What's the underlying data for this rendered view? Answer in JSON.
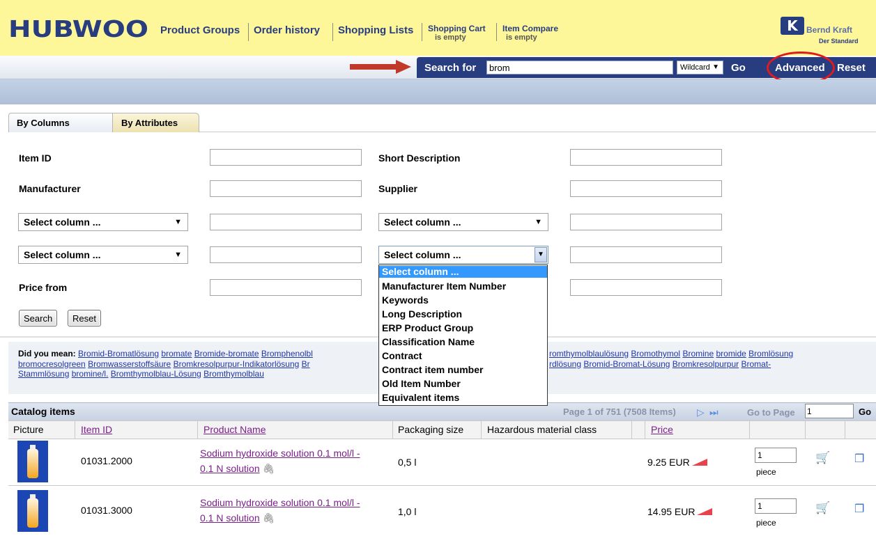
{
  "header": {
    "logo": "HUBWOO",
    "nav": [
      "Product Groups",
      "Order history",
      "Shopping Lists"
    ],
    "shopping_cart": "Shopping Cart",
    "shopping_cart_status": "is empty",
    "item_compare": "Item Compare",
    "item_compare_status": "is empty",
    "brand_mark": "K",
    "brand_name": "Bernd Kraft",
    "brand_tagline": "Der Standard"
  },
  "search": {
    "label": "Search for",
    "value": "brom",
    "mode": "Wildcard",
    "go": "Go",
    "advanced": "Advanced",
    "reset": "Reset"
  },
  "tabs": [
    "By Columns",
    "By Attributes"
  ],
  "form": {
    "item_id": "Item ID",
    "short_description": "Short Description",
    "manufacturer": "Manufacturer",
    "supplier": "Supplier",
    "select_column": "Select column ...",
    "price_from": "Price from",
    "search_button": "Search",
    "reset_button": "Reset"
  },
  "dropdown_options": [
    "Select column ...",
    "Manufacturer Item Number",
    "Keywords",
    "Long Description",
    "ERP Product Group",
    "Classification Name",
    "Contract",
    "Contract item number",
    "Old Item Number",
    "Equivalent items"
  ],
  "did_you_mean": {
    "label": "Did you mean:",
    "line1": [
      "Bromid-Bromatlösung",
      "bromate",
      "Bromide-bromate",
      "Bromphenolbl"
    ],
    "line1_right": [
      "romthymolblaulösung",
      "Bromothymol",
      "Bromine",
      "bromide",
      "Bromlösung"
    ],
    "line2": [
      "bromocresolgreen",
      "Bromwasserstoffsäure",
      "Bromkresolpurpur-Indikatorlösung",
      "Br"
    ],
    "line2_right": [
      "rdlösung",
      "Bromid-Bromat-Lösung",
      "Bromkresolpurpur",
      "Bromat-"
    ],
    "line3": [
      "Stammlösung",
      "bromine/l.",
      "Bromthymolblau-Lösung",
      "Bromthymolblau"
    ]
  },
  "catalog": {
    "title": "Catalog items",
    "page_info": "Page 1 of 751 (7508 Items)",
    "go_to_page": "Go to Page",
    "go_to_page_value": "1",
    "go": "Go",
    "columns": [
      "Picture",
      "Item ID",
      "Product Name",
      "Packaging size",
      "Hazardous material class",
      "Price"
    ],
    "rows": [
      {
        "item_id": "01031.2000",
        "name_line1": "Sodium hydroxide solution 0.1 mol/l -",
        "name_line2": "0.1 N solution",
        "packaging": "0,5 l",
        "hazard": "",
        "price": "9.25 EUR",
        "qty": "1",
        "unit": "piece"
      },
      {
        "item_id": "01031.3000",
        "name_line1": "Sodium hydroxide solution 0.1 mol/l -",
        "name_line2": "0.1 N solution",
        "packaging": "1,0 l",
        "hazard": "",
        "price": "14.95 EUR",
        "qty": "1",
        "unit": "piece"
      }
    ]
  },
  "colors": {
    "header_bg": "#fdf79a",
    "navy": "#283c80",
    "link_purple": "#7a1f8a",
    "highlight_red": "#e11b1b",
    "selection_blue": "#3399ff"
  }
}
